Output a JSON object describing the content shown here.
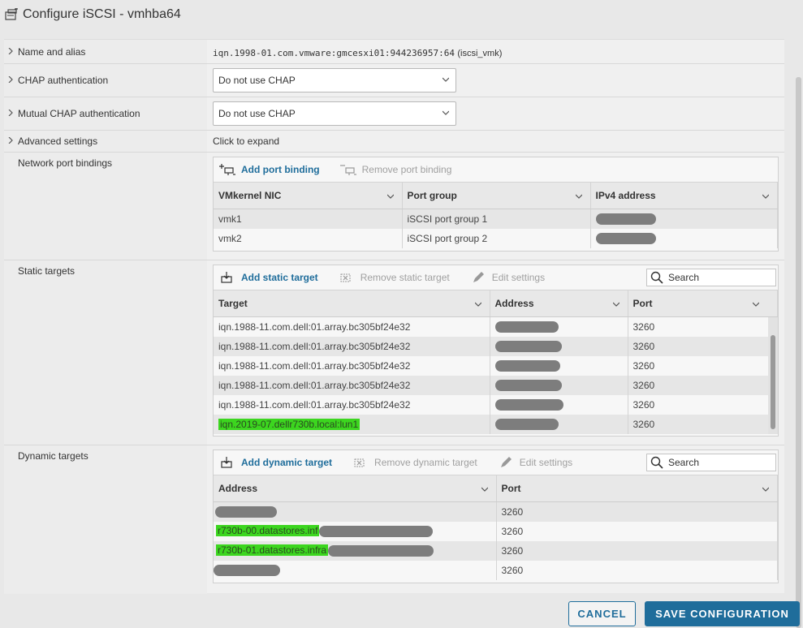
{
  "dialog": {
    "title": "Configure iSCSI - vmhba64"
  },
  "rows": {
    "name_alias": {
      "label": "Name and alias",
      "value": "iqn.1998-01.com.vmware:gmcesxi01:944236957:64",
      "alias": "(iscsi_vmk)"
    },
    "chap": {
      "label": "CHAP authentication",
      "selected": "Do not use CHAP"
    },
    "mutual_chap": {
      "label": "Mutual CHAP authentication",
      "selected": "Do not use CHAP"
    },
    "advanced": {
      "label": "Advanced settings",
      "value": "Click to expand"
    },
    "port_bindings": {
      "label": "Network port bindings"
    },
    "static_targets": {
      "label": "Static targets"
    },
    "dynamic_targets": {
      "label": "Dynamic targets"
    }
  },
  "port_binding_panel": {
    "add_label": "Add port binding",
    "remove_label": "Remove port binding",
    "columns": [
      "VMkernel NIC",
      "Port group",
      "IPv4 address"
    ],
    "rows": [
      {
        "nic": "vmk1",
        "group": "iSCSI port group 1"
      },
      {
        "nic": "vmk2",
        "group": "iSCSI port group 2"
      }
    ]
  },
  "static_panel": {
    "add_label": "Add static target",
    "remove_label": "Remove static target",
    "edit_label": "Edit settings",
    "search_placeholder": "Search",
    "columns": [
      "Target",
      "Address",
      "Port"
    ],
    "rows": [
      {
        "target": "iqn.1988-11.com.dell:01.array.bc305bf24e32",
        "port": "3260"
      },
      {
        "target": "iqn.1988-11.com.dell:01.array.bc305bf24e32",
        "port": "3260"
      },
      {
        "target": "iqn.1988-11.com.dell:01.array.bc305bf24e32",
        "port": "3260"
      },
      {
        "target": "iqn.1988-11.com.dell:01.array.bc305bf24e32",
        "port": "3260"
      },
      {
        "target": "iqn.1988-11.com.dell:01.array.bc305bf24e32",
        "port": "3260"
      },
      {
        "target": "iqn.2019-07.dellr730b.local:lun1",
        "port": "3260"
      }
    ]
  },
  "dynamic_panel": {
    "add_label": "Add dynamic target",
    "remove_label": "Remove dynamic target",
    "edit_label": "Edit settings",
    "search_placeholder": "Search",
    "columns": [
      "Address",
      "Port"
    ],
    "rows": [
      {
        "address": "",
        "port": "3260"
      },
      {
        "address": "r730b-00.datastores.inf",
        "port": "3260"
      },
      {
        "address": "r730b-01.datastores.infra",
        "port": "3260"
      },
      {
        "address": "",
        "port": "3260"
      }
    ]
  },
  "footer": {
    "cancel_label": "CANCEL",
    "save_label": "SAVE CONFIGURATION"
  },
  "colors": {
    "accent": "#1f6d9b",
    "highlight": "#3cd61f",
    "redaction": "#7d7d7d"
  }
}
